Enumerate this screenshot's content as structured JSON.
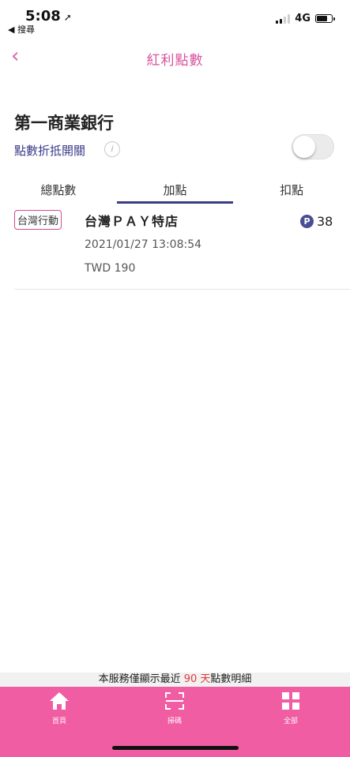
{
  "status_bar": {
    "time": "5:08",
    "back_app": "◀ 搜尋",
    "network": "4G"
  },
  "header": {
    "title": "紅利點數",
    "back_icon": "chevron-left-icon"
  },
  "bank": {
    "name": "第一商業銀行",
    "toggle_label": "點數折抵開關",
    "toggle_on": false
  },
  "tabs": [
    {
      "label": "總點數",
      "active": false
    },
    {
      "label": "加點",
      "active": true
    },
    {
      "label": "扣點",
      "active": false
    }
  ],
  "records": [
    {
      "badge": "台灣行動",
      "merchant": "台灣ＰＡＹ特店",
      "points": "38",
      "points_icon": "P",
      "datetime": "2021/01/27 13:08:54",
      "amount": "TWD 190"
    }
  ],
  "notice": {
    "prefix": "本服務僅顯示最近",
    "highlight": " 90 天",
    "suffix": "點數明細"
  },
  "bottom_nav": [
    {
      "label": "首頁",
      "icon": "home-icon"
    },
    {
      "label": "掃碼",
      "icon": "scan-icon"
    },
    {
      "label": "全部",
      "icon": "grid-icon"
    }
  ],
  "colors": {
    "accent": "#f05da3",
    "title": "#d9519c",
    "tab_indicator": "#3a3c83",
    "highlight": "#e53a3a"
  }
}
